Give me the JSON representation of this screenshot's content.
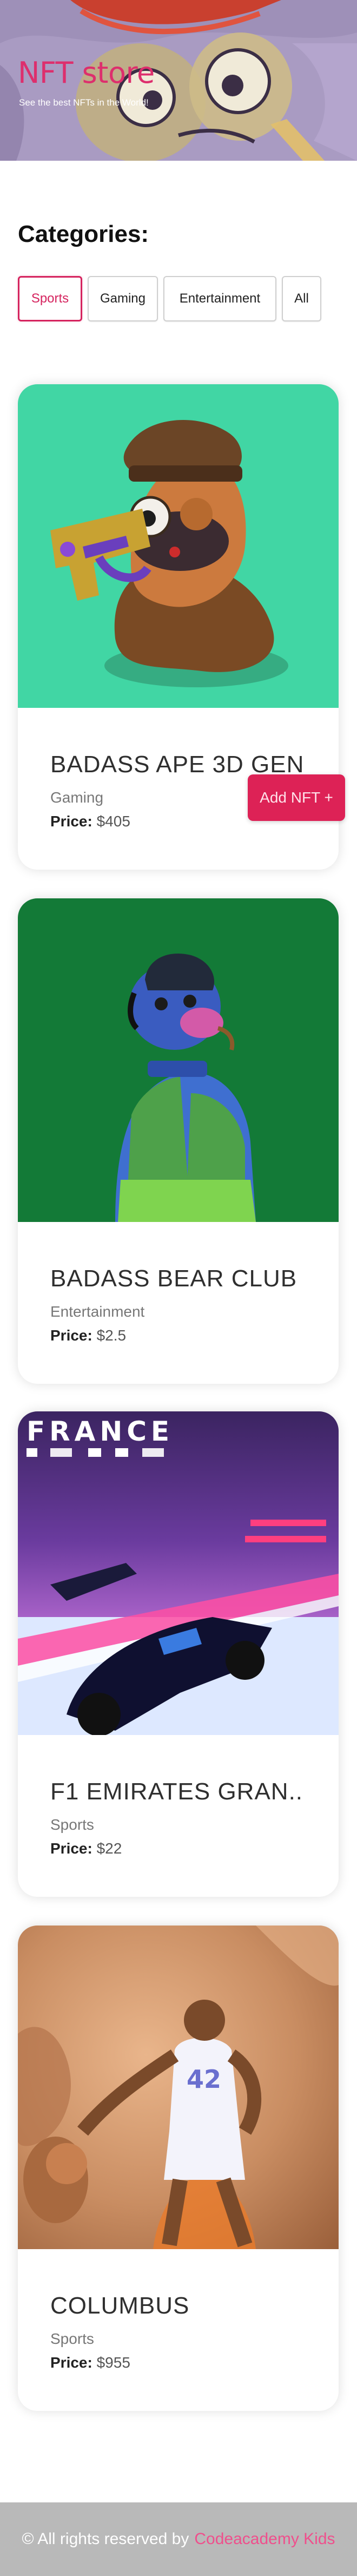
{
  "hero": {
    "title": "NFT store",
    "subtitle": "See the best NFTs in the World!"
  },
  "categories": {
    "heading": "Categories:",
    "items": [
      {
        "label": "Sports",
        "active": true
      },
      {
        "label": "Gaming",
        "active": false
      },
      {
        "label": "Entertainment",
        "active": false
      },
      {
        "label": "All",
        "active": false
      }
    ]
  },
  "cards": [
    {
      "title": "BADASS APE 3D GEN...",
      "category": "Gaming",
      "price_label": "Price:",
      "price": "$405",
      "image_bg": "#41d6a4"
    },
    {
      "title": "BADASS BEAR CLUB ...",
      "category": "Entertainment",
      "price_label": "Price:",
      "price": "$2.5",
      "image_bg": "#137a37"
    },
    {
      "title": "F1 EMIRATES GRAN...",
      "category": "Sports",
      "price_label": "Price:",
      "price": "$22",
      "image_bg": "#4a2f86",
      "image_text": "FRANCE"
    },
    {
      "title": "COLUMBUS",
      "category": "Sports",
      "price_label": "Price:",
      "price": "$955",
      "image_bg": "#c98d62",
      "image_text": "42"
    }
  ],
  "add_nft_button": {
    "label": "Add NFT +"
  },
  "footer": {
    "text": "© All rights reserved by",
    "link": "Codeacademy Kids"
  },
  "colors": {
    "accent": "#dd2256",
    "hero_title": "#dd2f6d",
    "footer_bg": "#b9b9b9",
    "footer_link": "#ef4f8c"
  }
}
